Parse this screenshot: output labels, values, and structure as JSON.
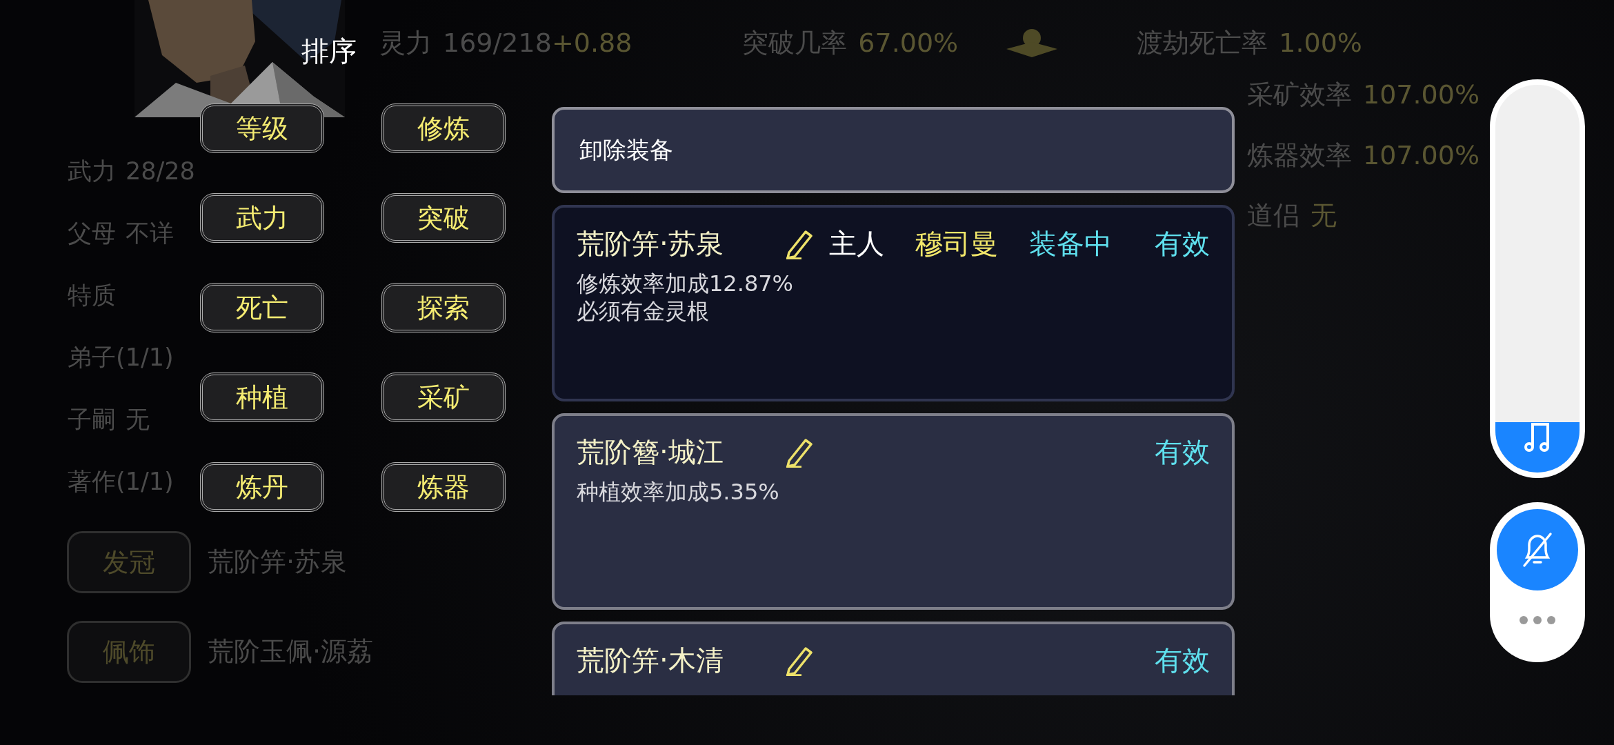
{
  "top_stats": [
    {
      "label": "灵力",
      "value": "169/218",
      "bonus": "+0.88"
    },
    {
      "label": "突破几率",
      "value": "67.00%"
    },
    {
      "label": "渡劫死亡率",
      "value": "1.00%"
    }
  ],
  "right_stats": [
    {
      "label": "采矿效率",
      "value": "107.00%"
    },
    {
      "label": "炼器效率",
      "value": "107.00%"
    },
    {
      "label": "道侣",
      "value": "无"
    }
  ],
  "attributes": [
    {
      "label": "武力",
      "value": "28/28"
    },
    {
      "label": "父母",
      "value": "不详"
    },
    {
      "label": "特质"
    },
    {
      "label": "弟子(1/1)"
    },
    {
      "label": "子嗣",
      "value": "无"
    },
    {
      "label": "著作(1/1)"
    }
  ],
  "slots": [
    {
      "label": "发冠",
      "item": "荒阶笄·苏泉"
    },
    {
      "label": "佩饰",
      "item": "荒阶玉佩·源荔"
    }
  ],
  "sort_menu": {
    "title": "排序",
    "options": [
      "等级",
      "修炼",
      "武力",
      "突破",
      "死亡",
      "探索",
      "种植",
      "采矿",
      "炼丹",
      "炼器"
    ]
  },
  "equipment_panel": {
    "unequip": "卸除装备",
    "items": [
      {
        "name": "荒阶笄·苏泉",
        "owner_label": "主人",
        "owner": "穆司曼",
        "status": "装备中",
        "validity": "有效",
        "equipped": true,
        "effects": [
          "修炼效率加成12.87%",
          "必须有金灵根"
        ]
      },
      {
        "name": "荒阶簪·城江",
        "validity": "有效",
        "equipped": false,
        "effects": [
          "种植效率加成5.35%"
        ]
      },
      {
        "name": "荒阶笄·木清",
        "validity": "有效",
        "equipped": false
      }
    ]
  },
  "volume": {
    "level": 0.13
  }
}
